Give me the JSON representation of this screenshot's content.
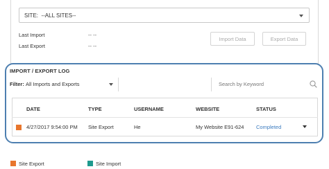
{
  "site": {
    "label": "SITE:",
    "value": "--ALL SITES--"
  },
  "info": {
    "last_import_label": "Last Import",
    "last_import_value": "-- --",
    "last_export_label": "Last Export",
    "last_export_value": "-- --"
  },
  "buttons": {
    "import": "Import Data",
    "export": "Export Data"
  },
  "log": {
    "title": "IMPORT / EXPORT LOG",
    "filter_label": "Filter:",
    "filter_value": "All Imports and Exports",
    "search_placeholder": "Search by Keyword"
  },
  "table": {
    "headers": {
      "date": "DATE",
      "type": "TYPE",
      "username": "USERNAME",
      "website": "WEBSITE",
      "status": "STATUS"
    },
    "rows": [
      {
        "date": "4/27/2017 9:54:00 PM",
        "type": "Site Export",
        "username": "He",
        "website": "My Website E91-624",
        "status": "Completed",
        "color": "#e8762d"
      }
    ]
  },
  "legend": [
    {
      "label": "Site Export",
      "color": "#e8762d"
    },
    {
      "label": "Site Import",
      "color": "#1e9a8e"
    }
  ],
  "colors": {
    "accent_border": "#4d7fb0",
    "link": "#3b7bbf",
    "export": "#e8762d",
    "import": "#1e9a8e"
  }
}
